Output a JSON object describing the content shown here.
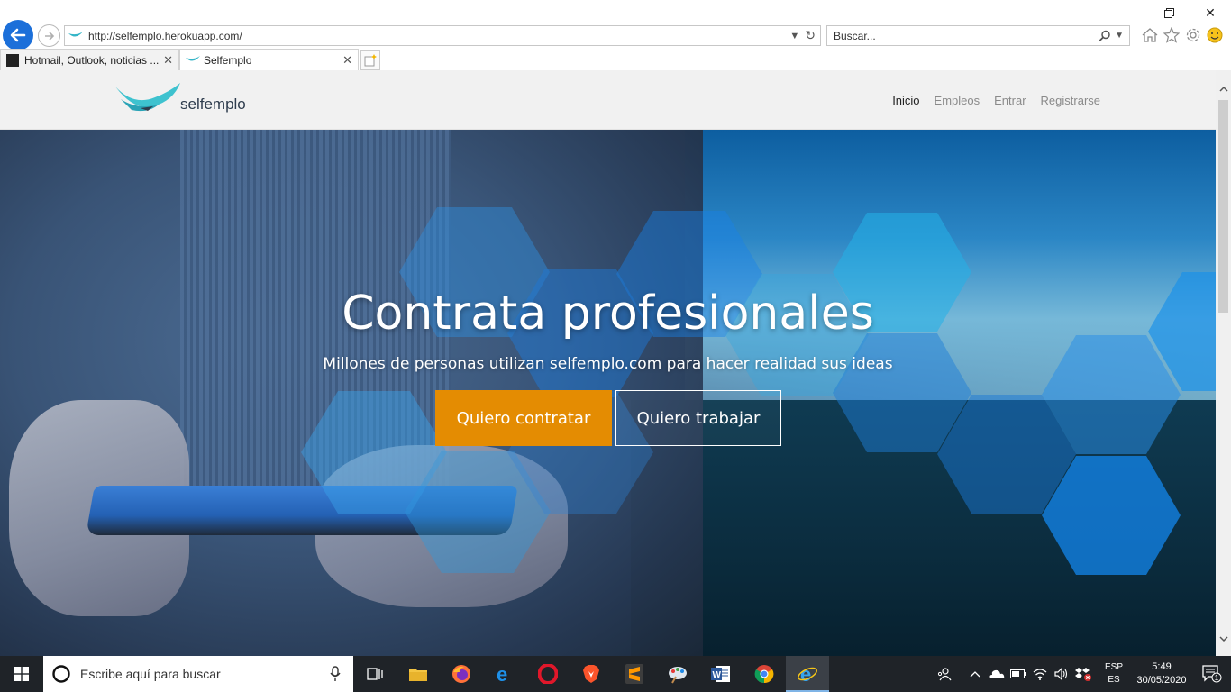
{
  "browser": {
    "address": "http://selfemplo.herokuapp.com/",
    "search_placeholder": "Buscar...",
    "tabs": [
      {
        "label": "Hotmail, Outlook, noticias ..."
      },
      {
        "label": "Selfemplo"
      }
    ]
  },
  "site": {
    "logo_text": "selfemplo",
    "nav": [
      {
        "label": "Inicio"
      },
      {
        "label": "Empleos"
      },
      {
        "label": "Entrar"
      },
      {
        "label": "Registrarse"
      }
    ]
  },
  "hero": {
    "title": "Contrata profesionales",
    "subtitle": "Millones de personas utilizan selfemplo.com para hacer realidad sus ideas",
    "btn_hire": "Quiero contratar",
    "btn_work": "Quiero trabajar"
  },
  "taskbar": {
    "search_placeholder": "Escribe aquí para buscar",
    "lang_top": "ESP",
    "lang_bottom": "ES",
    "time": "5:49",
    "date": "30/05/2020",
    "notification_count": "1"
  },
  "colors": {
    "accent_orange": "#e48c02",
    "nav_active": "#222222",
    "nav_inactive": "#8a8a8a"
  }
}
